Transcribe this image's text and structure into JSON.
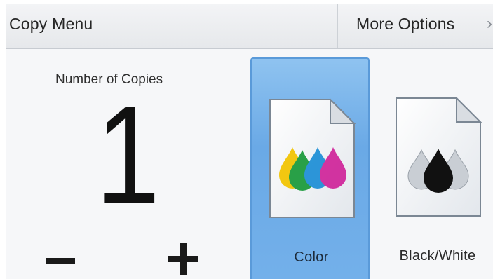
{
  "header": {
    "title": "Copy Menu",
    "more_options": "More Options",
    "more_arrow": "›"
  },
  "copies": {
    "label": "Number of Copies",
    "value": "1",
    "decrement_icon": "minus-icon",
    "increment_icon": "plus-icon"
  },
  "modes": [
    {
      "label": "Color",
      "selected": true,
      "icon": "color-ink-drops-icon"
    },
    {
      "label": "Black/White",
      "selected": false,
      "icon": "black-ink-drops-icon"
    }
  ],
  "colors": {
    "selected_tile": "#6aa9e6",
    "ink_yellow": "#f2c400",
    "ink_green": "#1a9a3a",
    "ink_cyan": "#1e8fd6",
    "ink_magenta": "#d0259a",
    "ink_black": "#111111"
  }
}
